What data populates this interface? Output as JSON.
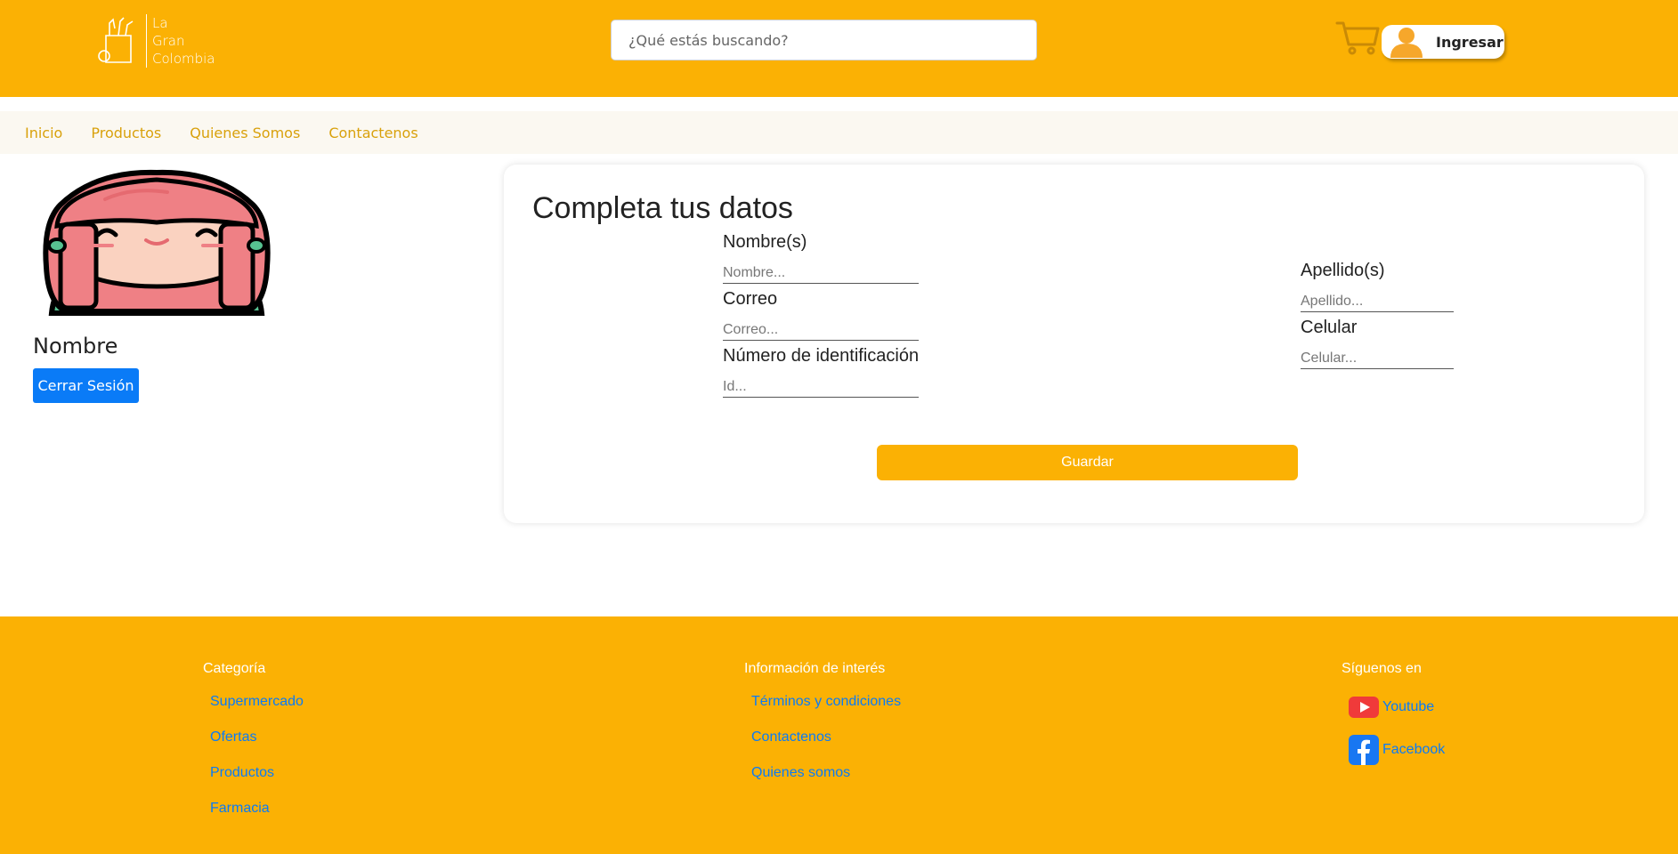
{
  "header": {
    "logo_lines": [
      "La",
      "Gran",
      "Colombia"
    ],
    "search_placeholder": "¿Qué estás buscando?",
    "login_label": "Ingresar"
  },
  "nav": {
    "items": [
      "Inicio",
      "Productos",
      "Quienes Somos",
      "Contactenos"
    ]
  },
  "profile": {
    "name": "Nombre",
    "logout_label": "Cerrar Sesión"
  },
  "form": {
    "title": "Completa tus datos",
    "first_name_label": "Nombre(s)",
    "first_name_placeholder": "Nombre...",
    "last_name_label": "Apellido(s)",
    "last_name_placeholder": "Apellido...",
    "email_label": "Correo",
    "email_placeholder": "Correo...",
    "phone_label": "Celular",
    "phone_placeholder": "Celular...",
    "id_label": "Número de identificación",
    "id_placeholder": "Id...",
    "save_label": "Guardar"
  },
  "footer": {
    "category_title": "Categoría",
    "category_links": [
      "Supermercado",
      "Ofertas",
      "Productos",
      "Farmacia"
    ],
    "info_title": "Información de interés",
    "info_links": [
      "Términos y condiciones",
      "Contactenos",
      "Quienes somos"
    ],
    "social_title": "Síguenos en",
    "social_links": [
      "Youtube",
      "Facebook"
    ]
  },
  "colors": {
    "brand": "#fbb104",
    "primary": "#0a7bf7",
    "nav_text": "#d9a10c"
  }
}
